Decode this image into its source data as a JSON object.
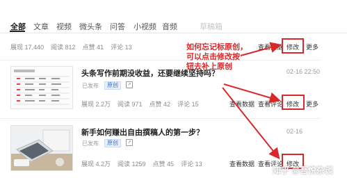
{
  "tabs": [
    {
      "label": "全部",
      "active": true
    },
    {
      "label": "文章"
    },
    {
      "label": "视频"
    },
    {
      "label": "微头条"
    },
    {
      "label": "问答"
    },
    {
      "label": "小视频"
    },
    {
      "label": "音频"
    },
    {
      "label": "草稿箱",
      "faint": true
    }
  ],
  "row0": {
    "stats": [
      "展现 17,440",
      "阅读 812",
      "点赞 41",
      "评论 13"
    ],
    "actions": [
      "查看数据",
      "修改",
      "更多"
    ]
  },
  "row1": {
    "title": "头条写作前期没收益，还要继续坚持吗？",
    "date": "02-16 22:50",
    "status": "已发布",
    "badge": "原创",
    "stats": [
      "展现 2.2万",
      "阅读 971",
      "点赞 42",
      "评论 15"
    ],
    "actions": [
      "查看数据",
      "查看评论",
      "修改",
      "更多"
    ]
  },
  "row2": {
    "title": "新手如何赚出自由撰稿人的第一步？",
    "date": "02-16",
    "status": "已发布",
    "badge": "原创",
    "stats": [
      "展现 4.2万",
      "阅读 1259",
      "点赞 45",
      "评论 13"
    ],
    "actions": [
      "查看数据",
      "查看评论",
      "修改"
    ]
  },
  "annotation": {
    "lines": [
      "如何忘记标原创，",
      "可以点击修改按",
      "钮去补上原创"
    ],
    "color": "#d8282a"
  },
  "watermark": "知乎 @吾悦杂谈"
}
